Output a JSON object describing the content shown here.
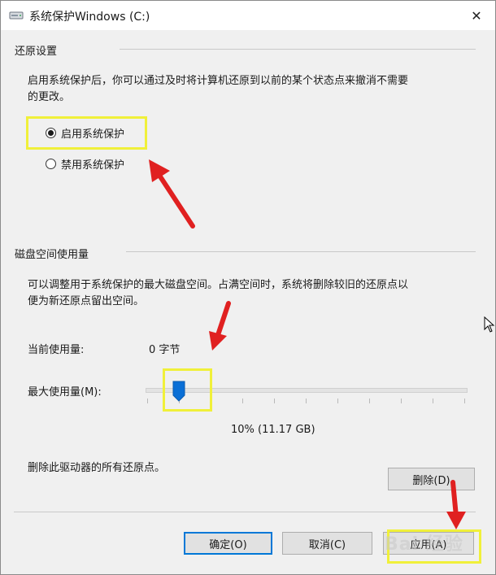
{
  "window": {
    "title": "系统保护Windows (C:)"
  },
  "restore": {
    "group_label": "还原设置",
    "description_line1": "启用系统保护后，你可以通过及时将计算机还原到以前的某个状态点来撤消不需要",
    "description_line2": "的更改。",
    "enable_label": "启用系统保护",
    "disable_label": "禁用系统保护",
    "selected": "enable"
  },
  "disk": {
    "group_label": "磁盘空间使用量",
    "description_line1": "可以调整用于系统保护的最大磁盘空间。占满空间时，系统将删除较旧的还原点以",
    "description_line2": "便为新还原点留出空间。",
    "current_usage_label": "当前使用量:",
    "current_usage_value": "0 字节",
    "max_usage_label": "最大使用量(M):",
    "slider_percent": 10,
    "max_usage_value": "10% (11.17 GB)",
    "delete_text": "删除此驱动器的所有还原点。",
    "delete_button": "删除(D)"
  },
  "buttons": {
    "ok": "确定(O)",
    "cancel": "取消(C)",
    "apply": "应用(A)"
  },
  "watermark": "Bai 经验",
  "colors": {
    "highlight": "#f0f03a",
    "arrow": "#e02020",
    "accent": "#0078d7"
  }
}
